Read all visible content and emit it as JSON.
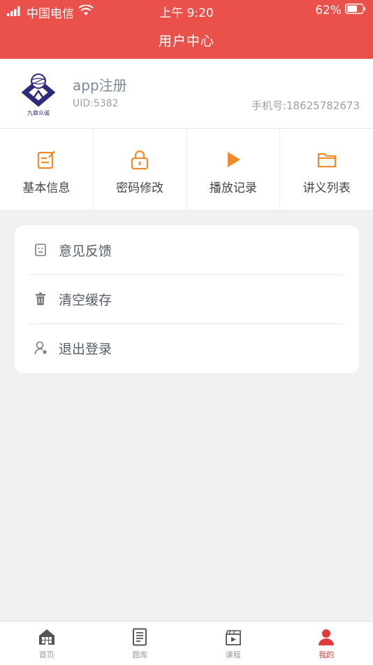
{
  "status_bar": {
    "carrier": "中国电信",
    "time": "上午 9:20",
    "battery": "62%"
  },
  "header": {
    "title": "用户中心"
  },
  "profile": {
    "name": "app注册",
    "uid": "UID:5382",
    "phone": "手机号:18625782673",
    "logo_text": "九章众诚"
  },
  "shortcuts": [
    {
      "label": "基本信息",
      "icon": "edit-icon"
    },
    {
      "label": "密码修改",
      "icon": "lock-icon"
    },
    {
      "label": "播放记录",
      "icon": "play-icon"
    },
    {
      "label": "讲义列表",
      "icon": "folder-icon"
    }
  ],
  "menu": [
    {
      "label": "意见反馈",
      "icon": "feedback-icon"
    },
    {
      "label": "清空缓存",
      "icon": "trash-icon"
    },
    {
      "label": "退出登录",
      "icon": "user-logout-icon"
    }
  ],
  "tabs": [
    {
      "label": "首页",
      "icon": "home-icon"
    },
    {
      "label": "题库",
      "icon": "document-icon"
    },
    {
      "label": "课程",
      "icon": "video-icon"
    },
    {
      "label": "我的",
      "icon": "person-icon"
    }
  ],
  "colors": {
    "brand": "#e9514a",
    "accent": "#f08a2b",
    "active_tab": "#e03a3a"
  }
}
